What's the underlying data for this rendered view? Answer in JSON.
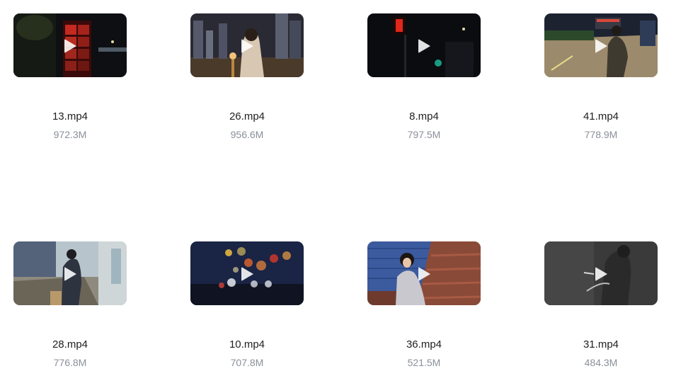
{
  "files": [
    {
      "name": "13.mp4",
      "size": "972.3M",
      "thumb_icon": "play-icon"
    },
    {
      "name": "26.mp4",
      "size": "956.6M",
      "thumb_icon": "play-icon"
    },
    {
      "name": "8.mp4",
      "size": "797.5M",
      "thumb_icon": "play-icon"
    },
    {
      "name": "41.mp4",
      "size": "778.9M",
      "thumb_icon": "play-icon"
    },
    {
      "name": "28.mp4",
      "size": "776.8M",
      "thumb_icon": "play-icon"
    },
    {
      "name": "10.mp4",
      "size": "707.8M",
      "thumb_icon": "play-icon"
    },
    {
      "name": "36.mp4",
      "size": "521.5M",
      "thumb_icon": "play-icon"
    },
    {
      "name": "31.mp4",
      "size": "484.3M",
      "thumb_icon": "play-icon"
    }
  ],
  "colors": {
    "filename": "#1f1f1f",
    "filesize": "#8a8f99",
    "background": "#ffffff"
  }
}
